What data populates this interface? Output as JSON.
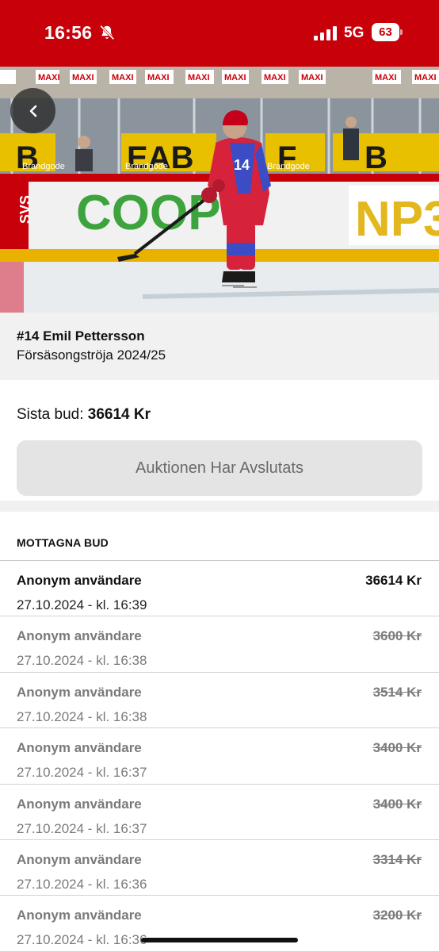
{
  "status_bar": {
    "time": "16:56",
    "network": "5G",
    "battery": "63",
    "background": "#c8000a"
  },
  "hero": {
    "image": "hockey player in red and blue jersey number 14 skating on ice",
    "ad_texts": [
      "MAXI",
      "COOP",
      "Brandgode",
      "NP3"
    ]
  },
  "item": {
    "title": "#14 Emil Pettersson",
    "subtitle": "Försäsongströja 2024/25"
  },
  "bid": {
    "last_bid_label": "Sista bud:",
    "last_bid_value": "36614 Kr",
    "ended_button": "Auktionen Har Avslutats"
  },
  "bids": {
    "header": "MOTTAGNA BUD",
    "items": [
      {
        "user": "Anonym användare",
        "amount": "36614 Kr",
        "time": "27.10.2024 - kl. 16:39",
        "outbid": false
      },
      {
        "user": "Anonym användare",
        "amount": "3600 Kr",
        "time": "27.10.2024 - kl. 16:38",
        "outbid": true
      },
      {
        "user": "Anonym användare",
        "amount": "3514 Kr",
        "time": "27.10.2024 - kl. 16:38",
        "outbid": true
      },
      {
        "user": "Anonym användare",
        "amount": "3400 Kr",
        "time": "27.10.2024 - kl. 16:37",
        "outbid": true
      },
      {
        "user": "Anonym användare",
        "amount": "3400 Kr",
        "time": "27.10.2024 - kl. 16:37",
        "outbid": true
      },
      {
        "user": "Anonym användare",
        "amount": "3314 Kr",
        "time": "27.10.2024 - kl. 16:36",
        "outbid": true
      },
      {
        "user": "Anonym användare",
        "amount": "3200 Kr",
        "time": "27.10.2024 - kl. 16:36",
        "outbid": true
      }
    ]
  }
}
